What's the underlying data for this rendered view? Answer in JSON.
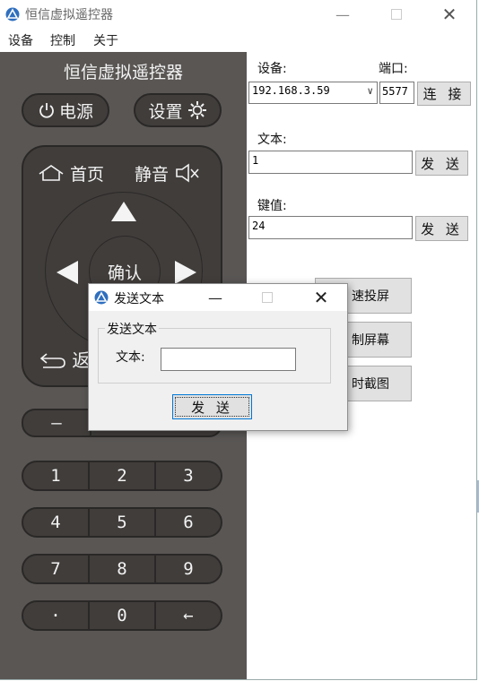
{
  "window": {
    "title": "恒信虚拟遥控器"
  },
  "menu": [
    "设备",
    "控制",
    "关于"
  ],
  "remote": {
    "title": "恒信虚拟遥控器",
    "power_label": "电源",
    "settings_label": "设置",
    "home_label": "首页",
    "mute_label": "静音",
    "ok_label": "确认",
    "back_label": "返",
    "vol_down_label": "—",
    "keypad": [
      [
        "1",
        "2",
        "3"
      ],
      [
        "4",
        "5",
        "6"
      ],
      [
        "7",
        "8",
        "9"
      ],
      [
        "·",
        "0",
        "←"
      ]
    ]
  },
  "device": {
    "device_label": "设备:",
    "port_label": "端口:",
    "ip_value": "192.168.3.59",
    "port_value": "5577",
    "connect_label": "连 接"
  },
  "text_send": {
    "label": "文本:",
    "value": "1",
    "send_label": "发 送"
  },
  "key_send": {
    "label": "键值:",
    "value": "24",
    "send_label": "发 送"
  },
  "side_buttons": [
    "速投屏",
    "制屏幕",
    "时截图"
  ],
  "dialog": {
    "title": "发送文本",
    "group_label": "发送文本",
    "field_label": "文本:",
    "field_value": "",
    "send_label": "发 送"
  },
  "colors": {
    "remote_bg": "#595654",
    "button_bg": "#403d3b",
    "accent": "#0078d7"
  }
}
